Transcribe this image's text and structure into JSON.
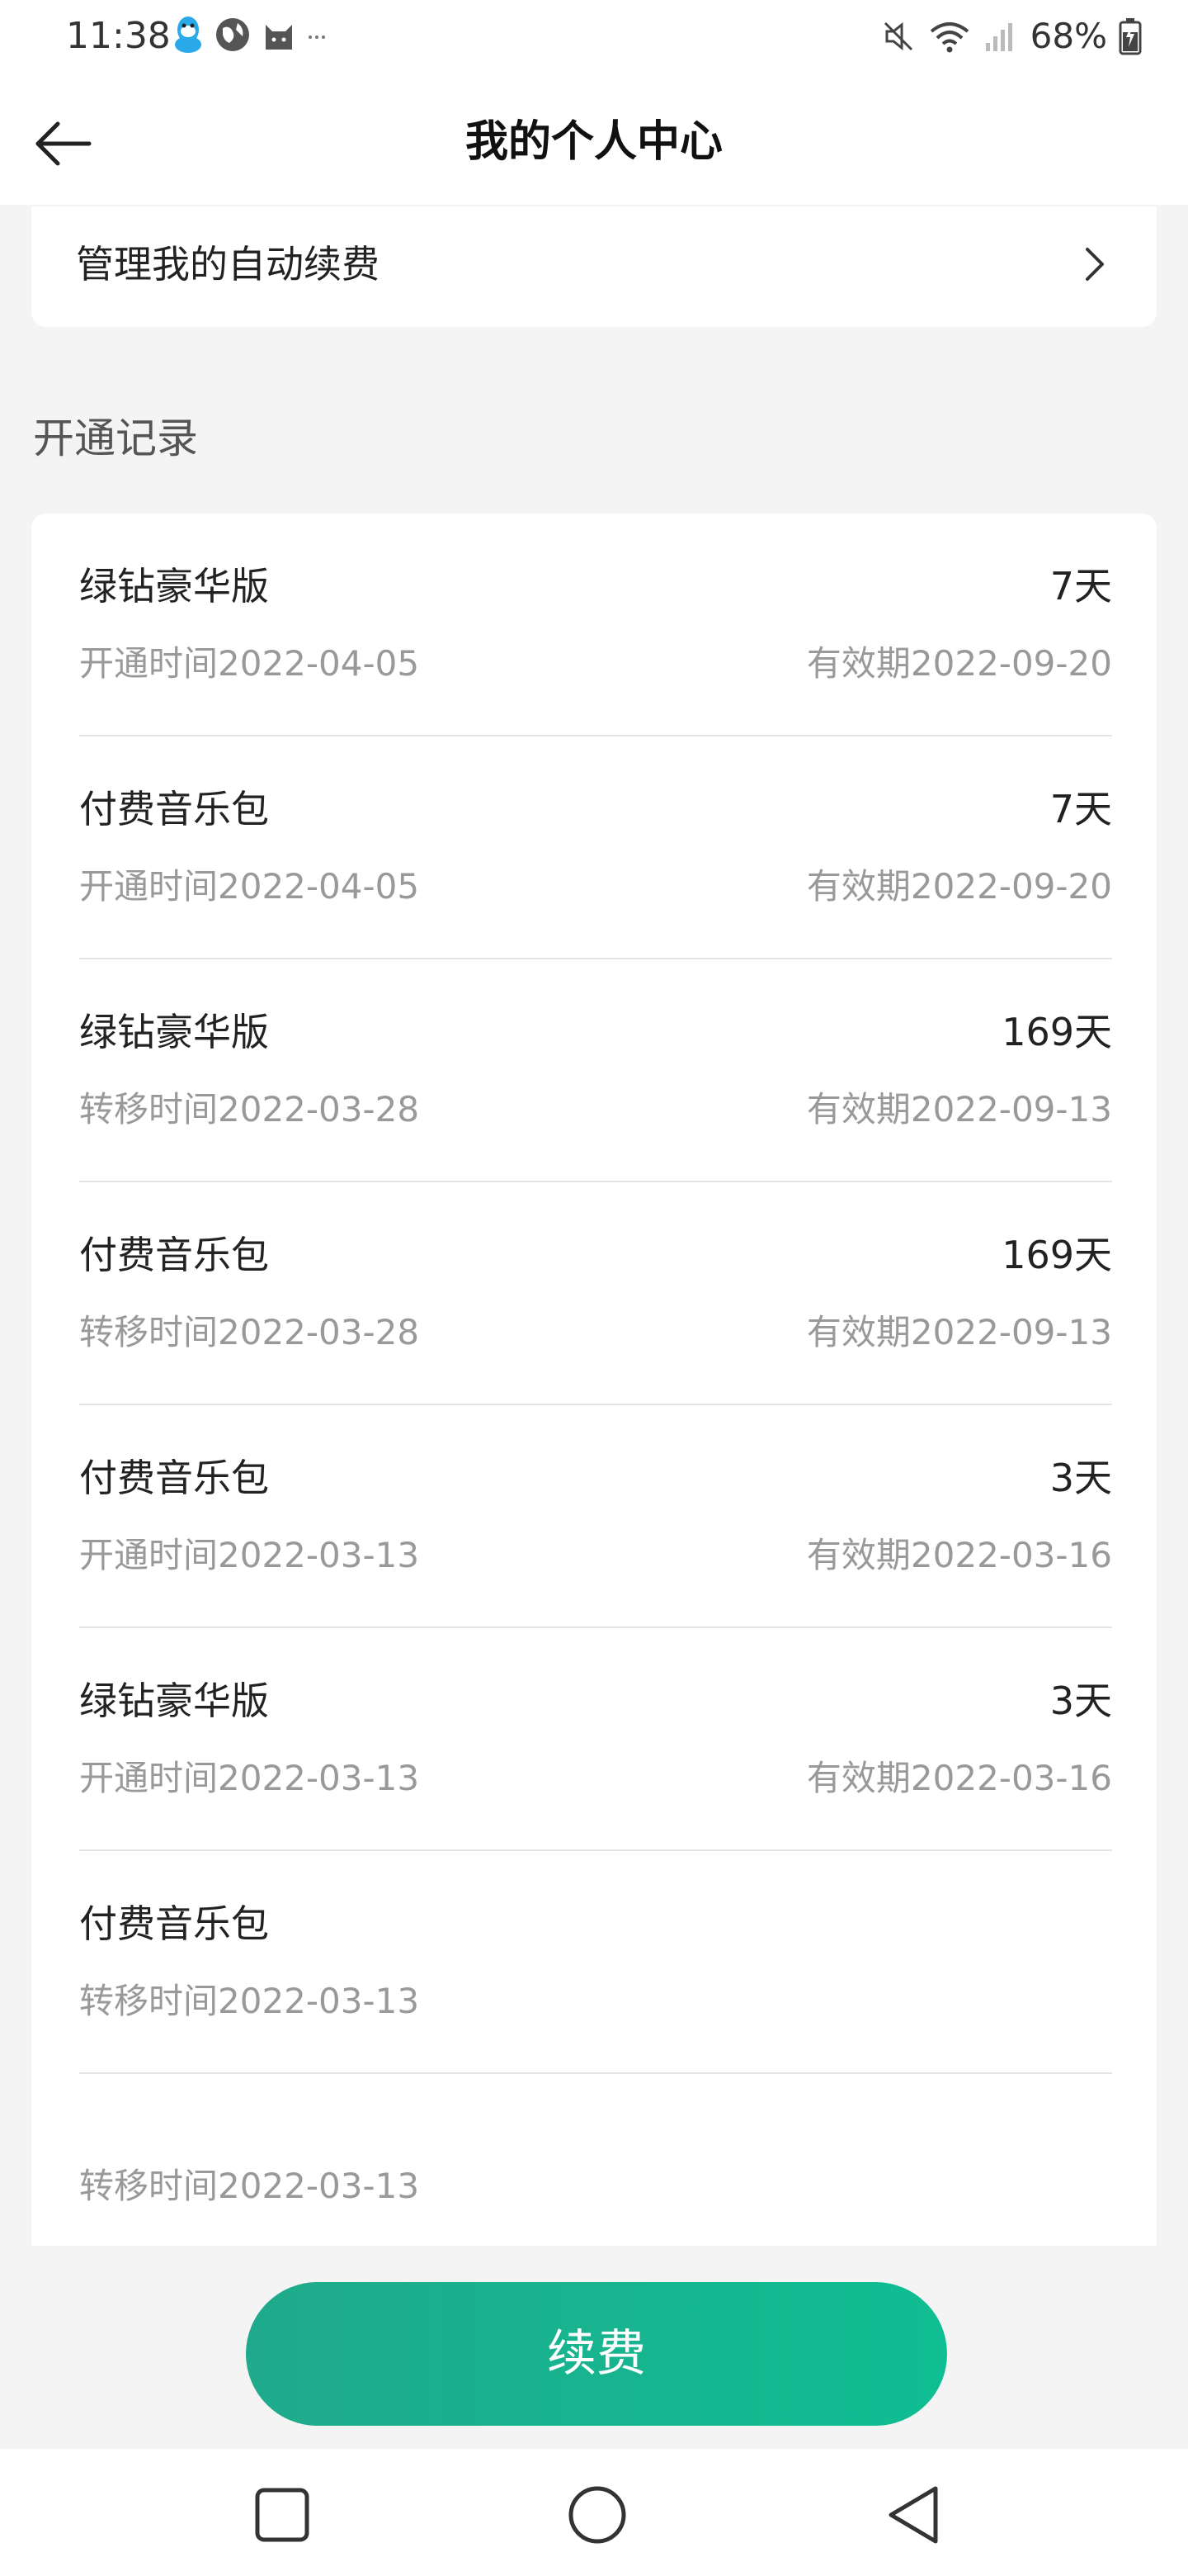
{
  "status_bar": {
    "time": "11:38",
    "battery": "68%",
    "left_icons": [
      "qq-icon",
      "globe-icon",
      "cat-icon",
      "more-dots-icon"
    ],
    "right_icons": [
      "mute-icon",
      "wifi-icon",
      "signal-icon",
      "battery-icon"
    ]
  },
  "header": {
    "title": "我的个人中心"
  },
  "auto_renew": {
    "label": "管理我的自动续费"
  },
  "section": {
    "title": "开通记录"
  },
  "records": [
    {
      "name": "绿钻豪华版",
      "days": "7天",
      "time": "开通时间2022-04-05",
      "valid": "有效期2022-09-20"
    },
    {
      "name": "付费音乐包",
      "days": "7天",
      "time": "开通时间2022-04-05",
      "valid": "有效期2022-09-20"
    },
    {
      "name": "绿钻豪华版",
      "days": "169天",
      "time": "转移时间2022-03-28",
      "valid": "有效期2022-09-13"
    },
    {
      "name": "付费音乐包",
      "days": "169天",
      "time": "转移时间2022-03-28",
      "valid": "有效期2022-09-13"
    },
    {
      "name": "付费音乐包",
      "days": "3天",
      "time": "开通时间2022-03-13",
      "valid": "有效期2022-03-16"
    },
    {
      "name": "绿钻豪华版",
      "days": "3天",
      "time": "开通时间2022-03-13",
      "valid": "有效期2022-03-16"
    },
    {
      "name": "付费音乐包",
      "days": "",
      "time": "转移时间2022-03-13",
      "valid": ""
    },
    {
      "name": "",
      "days": "",
      "time": "转移时间2022-03-13",
      "valid": ""
    }
  ],
  "renew_button": {
    "label": "续费"
  },
  "colors": {
    "accent_start": "#1faa8c",
    "accent_end": "#0fbe92",
    "page_bg": "#f4f4f5",
    "secondary_text": "#999999"
  },
  "nav_bar": {
    "icons": [
      "recent-apps-icon",
      "home-icon",
      "back-nav-icon"
    ]
  }
}
